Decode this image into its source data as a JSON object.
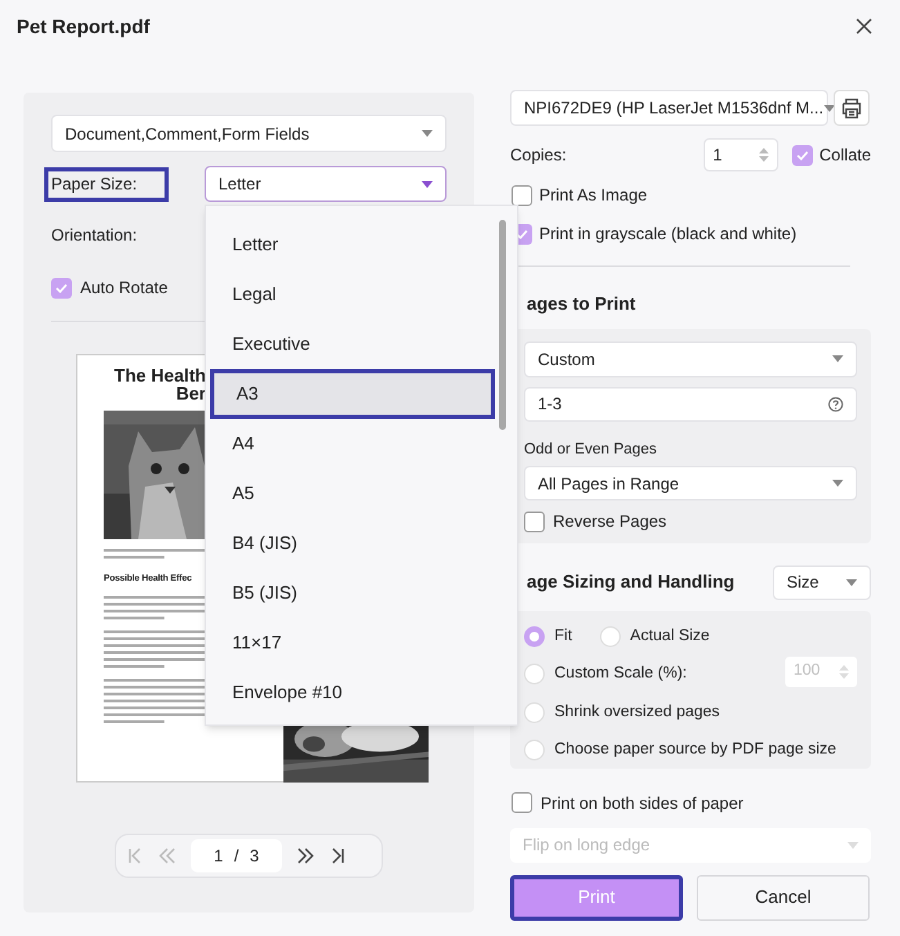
{
  "window": {
    "title": "Pet Report.pdf"
  },
  "left": {
    "content_select": "Document,Comment,Form Fields",
    "paper_size": {
      "label": "Paper Size:",
      "highlighted": true,
      "value": "Letter"
    },
    "orientation_label": "Orientation:",
    "auto_rotate": {
      "label": "Auto Rotate",
      "checked": true
    },
    "preview": {
      "title_lines": [
        "The Health",
        "Ber"
      ],
      "heading": "Possible Health Effec"
    },
    "pager": {
      "current": "1",
      "separator": "/",
      "total": "3"
    }
  },
  "paper_dropdown": {
    "options": [
      {
        "label": "Letter",
        "selected": false,
        "highlighted": false
      },
      {
        "label": "Legal",
        "selected": false,
        "highlighted": false
      },
      {
        "label": "Executive",
        "selected": false,
        "highlighted": false
      },
      {
        "label": "A3",
        "selected": true,
        "highlighted": true
      },
      {
        "label": "A4",
        "selected": false,
        "highlighted": false
      },
      {
        "label": "A5",
        "selected": false,
        "highlighted": false
      },
      {
        "label": "B4 (JIS)",
        "selected": false,
        "highlighted": false
      },
      {
        "label": "B5 (JIS)",
        "selected": false,
        "highlighted": false
      },
      {
        "label": "11×17",
        "selected": false,
        "highlighted": false
      },
      {
        "label": "Envelope #10",
        "selected": false,
        "highlighted": false
      }
    ]
  },
  "right": {
    "printer": "NPI672DE9 (HP LaserJet M1536dnf M...",
    "copies_label": "Copies:",
    "copies": "1",
    "collate": {
      "label": "Collate",
      "checked": true
    },
    "options": [
      {
        "label": "Print As Image",
        "checked": false
      },
      {
        "label": "Print in grayscale (black and white)",
        "checked": true
      }
    ],
    "pages_heading": "ages to Print",
    "range_select": "Custom",
    "range": "1-3",
    "odd_even_label": "Odd or Even Pages",
    "odd_even_select": "All Pages in Range",
    "reverse": {
      "label": "Reverse Pages",
      "checked": false
    },
    "sizing_heading": "age Sizing and Handling",
    "sizing_select": "Size",
    "sizing_options": [
      {
        "label": "Fit",
        "selected": true
      },
      {
        "label": "Actual Size",
        "selected": false
      },
      {
        "label": "Custom Scale (%):",
        "selected": false
      },
      {
        "label": "Shrink oversized pages",
        "selected": false
      },
      {
        "label": "Choose paper source by PDF page size",
        "selected": false
      }
    ],
    "scale": "100",
    "both_sides": {
      "label": "Print on both sides of paper",
      "checked": false
    },
    "flip_select": "Flip on long edge",
    "buttons": [
      {
        "label": "Print",
        "kind": "primary",
        "highlighted": true
      },
      {
        "label": "Cancel",
        "kind": "secondary",
        "highlighted": false
      }
    ]
  }
}
